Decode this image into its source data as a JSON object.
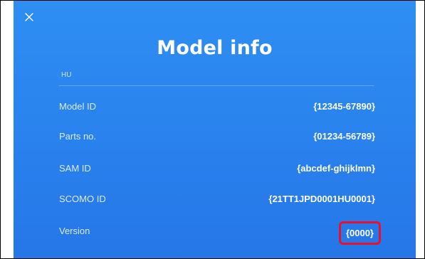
{
  "header": {
    "close_icon": "close-icon",
    "title": "Model info"
  },
  "section": {
    "label": "HU"
  },
  "rows": [
    {
      "label": "Model ID",
      "value": "{12345-67890}"
    },
    {
      "label": "Parts no.",
      "value": "{01234-56789}"
    },
    {
      "label": "SAM ID",
      "value": "{abcdef-ghijklmn}"
    },
    {
      "label": "SCOMO ID",
      "value": "{21TT1JPD0001HU0001}"
    },
    {
      "label": "Version",
      "value": "{0000}",
      "highlighted": true
    }
  ],
  "colors": {
    "background": "#2a84ee",
    "highlight_border": "#e8102a",
    "text": "#ffffff"
  }
}
